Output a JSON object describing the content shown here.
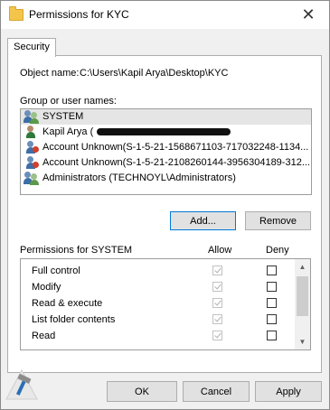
{
  "window": {
    "title": "Permissions for KYC",
    "close_glyph": "✕"
  },
  "tabs": [
    {
      "label": "Security"
    }
  ],
  "object": {
    "label": "Object name:",
    "value": "C:\\Users\\Kapil Arya\\Desktop\\KYC"
  },
  "groups": {
    "label": "Group or user names:",
    "users": [
      {
        "name": "SYSTEM",
        "icon": "users-icon",
        "selected": true
      },
      {
        "name": "Kapil Arya (",
        "icon": "user-icon",
        "redacted": true
      },
      {
        "name": "Account Unknown(S-1-5-21-1568671103-717032248-1134...",
        "icon": "unknown-account-icon"
      },
      {
        "name": "Account Unknown(S-1-5-21-2108260144-3956304189-312...",
        "icon": "unknown-account-icon"
      },
      {
        "name": "Administrators (TECHNOYL\\Administrators)",
        "icon": "users-icon"
      }
    ],
    "add_label": "Add...",
    "remove_label": "Remove"
  },
  "permissions": {
    "label": "Permissions for SYSTEM",
    "allow_label": "Allow",
    "deny_label": "Deny",
    "rows": [
      {
        "name": "Full control",
        "allow": true,
        "deny": false
      },
      {
        "name": "Modify",
        "allow": true,
        "deny": false
      },
      {
        "name": "Read & execute",
        "allow": true,
        "deny": false
      },
      {
        "name": "List folder contents",
        "allow": true,
        "deny": false
      },
      {
        "name": "Read",
        "allow": true,
        "deny": false
      }
    ]
  },
  "footer": {
    "ok_label": "OK",
    "cancel_label": "Cancel",
    "apply_label": "Apply"
  },
  "colors": {
    "accent": "#0078d7",
    "window_bg": "#f0f0f0",
    "panel_bg": "#ffffff",
    "selection_bg": "#e5e5e5"
  }
}
